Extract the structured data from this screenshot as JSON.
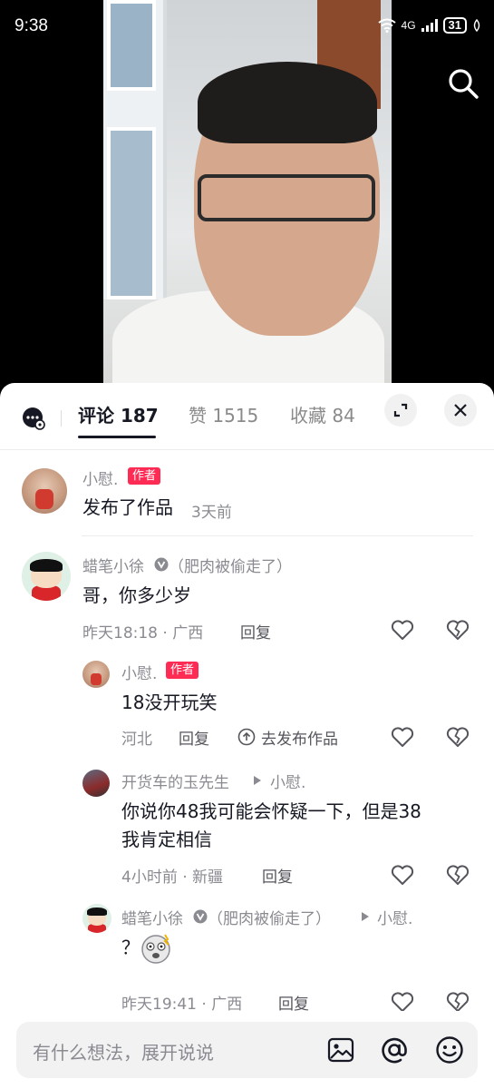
{
  "status_bar": {
    "time": "9:38",
    "network": "4G",
    "battery": "31"
  },
  "tabs": [
    {
      "label": "评论 187"
    },
    {
      "label": "赞 1515"
    },
    {
      "label": "收藏 84"
    }
  ],
  "comments": [
    {
      "user": "小慰.",
      "badge": "作者",
      "text": "发布了作品",
      "time": "3天前"
    },
    {
      "user": "蜡笔小徐",
      "suffix": "（肥肉被偷走了）",
      "text": "哥，你多少岁",
      "meta": "昨天18:18 · 广西",
      "reply": "回复"
    }
  ],
  "replies": [
    {
      "user": "小慰.",
      "badge": "作者",
      "text": "18没开玩笑",
      "meta": "河北",
      "reply": "回复",
      "action": "去发布作品"
    },
    {
      "user": "开货车的玉先生",
      "reply_to": "小慰.",
      "text_line1": "你说你48我可能会怀疑一下，但是38",
      "text_line2": "我肯定相信",
      "meta": "4小时前 · 新疆",
      "reply": "回复"
    },
    {
      "user": "蜡笔小徐",
      "suffix": "（肥肉被偷走了）",
      "reply_to": "小慰.",
      "text": "？",
      "meta": "昨天19:41 · 广西",
      "reply": "回复"
    }
  ],
  "input": {
    "placeholder": "有什么想法，展开说说"
  },
  "icons": [
    "search-icon",
    "chat-icon",
    "expand-icon",
    "close-icon",
    "like-icon",
    "dislike-icon",
    "image-icon",
    "at-icon",
    "emoji-icon"
  ],
  "colors": {
    "accent": "#fe2c55",
    "text": "#161823",
    "muted": "#8a8b91"
  }
}
